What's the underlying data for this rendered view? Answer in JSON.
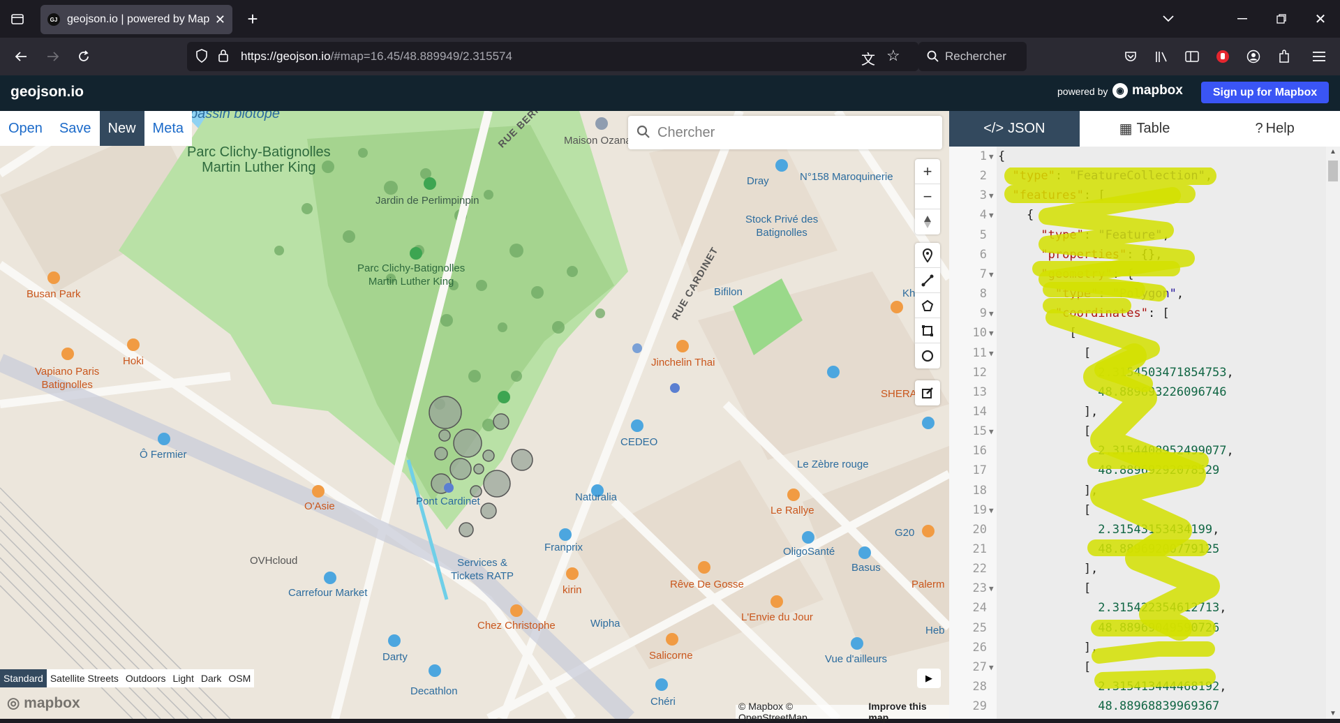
{
  "browser": {
    "tab_title": "geojson.io | powered by Mapbox",
    "tab_favicon": "GJ",
    "url_host": "https://geojson.io",
    "url_path": "/#map=16.45/48.889949/2.315574",
    "search_placeholder": "Rechercher"
  },
  "app": {
    "logo": "geojson.io",
    "powered_by": "powered by",
    "mapbox_brand": "mapbox",
    "signup_label": "Sign up for Mapbox"
  },
  "menu": {
    "open": "Open",
    "save": "Save",
    "new": "New",
    "meta": "Meta"
  },
  "map": {
    "search_placeholder": "Chercher",
    "styles": [
      "Standard",
      "Satellite Streets",
      "Outdoors",
      "Light",
      "Dark",
      "OSM"
    ],
    "watermark": "mapbox",
    "attribution": "© Mapbox © OpenStreetMap",
    "improve": "Improve this map",
    "labels": {
      "park_main": "Parc Clichy-Batignolles\nMartin Luther King",
      "park_small": "Parc Clichy-Batignolles\nMartin Luther King",
      "bassin": "bassin biotope",
      "jardin": "Jardin de Perlimpinpin",
      "maison": "Maison Ozana",
      "rue_bernard": "RUE BERNA",
      "dray": "Dray",
      "maroquinerie": "N°158 Maroquinerie",
      "stock": "Stock Privé des\nBatignolles",
      "rue_cardinet": "RUE CARDINET",
      "bifilon": "Bifilon",
      "jinchelin": "Jinchelin Thai",
      "shera": "SHERA",
      "busan": "Busan Park",
      "hoki": "Hoki",
      "vapiano": "Vapiano Paris\nBatignolles",
      "fermier": "Ô Fermier",
      "cedeo": "CEDEO",
      "zebre": "Le Zèbre rouge",
      "naturalia": "Naturalia",
      "pont_cardinet": "Pont Cardinet",
      "rallye": "Le Rallye",
      "oasie": "O'Asie",
      "g20": "G20",
      "franprix": "Franprix",
      "oligosante": "OligoSanté",
      "basus": "Basus",
      "ovhcloud": "OVHcloud",
      "services": "Services &\nTickets RATP",
      "carrefour": "Carrefour Market",
      "kirin": "kirin",
      "reve": "Rêve De Gosse",
      "palerme": "Palerm",
      "envie": "L'Envie du Jour",
      "chez": "Chez Christophe",
      "wipha": "Wipha",
      "darty": "Darty",
      "salicorne": "Salicorne",
      "vue": "Vue d'ailleurs",
      "heb": "Heb",
      "decathlon": "Decathlon",
      "cheri": "Chéri",
      "kh": "Kh"
    }
  },
  "panel": {
    "tabs": [
      "JSON",
      "Table",
      "Help"
    ],
    "code_lines": [
      {
        "n": "1",
        "fold": true,
        "code": "{"
      },
      {
        "n": "2",
        "fold": false,
        "code": "  \"type\": \"FeatureCollection\","
      },
      {
        "n": "3",
        "fold": true,
        "code": "  \"features\": ["
      },
      {
        "n": "4",
        "fold": true,
        "code": "    {"
      },
      {
        "n": "5",
        "fold": false,
        "code": "      \"type\": \"Feature\","
      },
      {
        "n": "6",
        "fold": false,
        "code": "      \"properties\": {},"
      },
      {
        "n": "7",
        "fold": true,
        "code": "      \"geometry\": {"
      },
      {
        "n": "8",
        "fold": false,
        "code": "        \"type\": \"Polygon\","
      },
      {
        "n": "9",
        "fold": true,
        "code": "        \"coordinates\": ["
      },
      {
        "n": "10",
        "fold": true,
        "code": "          ["
      },
      {
        "n": "11",
        "fold": true,
        "code": "            ["
      },
      {
        "n": "12",
        "fold": false,
        "code": "              2.3154503471854753,"
      },
      {
        "n": "13",
        "fold": false,
        "code": "              48.889693226096746"
      },
      {
        "n": "14",
        "fold": false,
        "code": "            ],"
      },
      {
        "n": "15",
        "fold": true,
        "code": "            ["
      },
      {
        "n": "16",
        "fold": false,
        "code": "              2.3154408952499077,"
      },
      {
        "n": "17",
        "fold": false,
        "code": "              48.88969292078529"
      },
      {
        "n": "18",
        "fold": false,
        "code": "            ],"
      },
      {
        "n": "19",
        "fold": true,
        "code": "            ["
      },
      {
        "n": "20",
        "fold": false,
        "code": "              2.31543153434199,"
      },
      {
        "n": "21",
        "fold": false,
        "code": "              48.88969200779125"
      },
      {
        "n": "22",
        "fold": false,
        "code": "            ],"
      },
      {
        "n": "23",
        "fold": true,
        "code": "            ["
      },
      {
        "n": "24",
        "fold": false,
        "code": "              2.315422354612713,"
      },
      {
        "n": "25",
        "fold": false,
        "code": "              48.88969049590726"
      },
      {
        "n": "26",
        "fold": false,
        "code": "            ],"
      },
      {
        "n": "27",
        "fold": true,
        "code": "            ["
      },
      {
        "n": "28",
        "fold": false,
        "code": "              2.315413444468192,"
      },
      {
        "n": "29",
        "fold": false,
        "code": "              48.88968839969367"
      }
    ]
  },
  "colors": {
    "header_bg": "#12232e",
    "active_tab": "#33495e",
    "signup": "#3a55f5",
    "highlighter": "#d4e000"
  }
}
